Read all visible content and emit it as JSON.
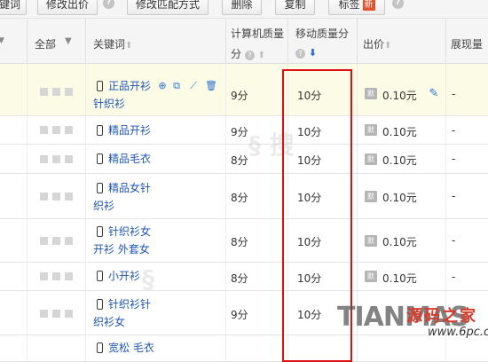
{
  "toolbar": {
    "btn_partial": "键词",
    "btn_modify_bid": "修改出价",
    "btn_modify_match": "修改匹配方式",
    "btn_delete": "删除",
    "btn_copy": "复制",
    "btn_tag": "标签",
    "badge_new": "新"
  },
  "header": {
    "col_all": "全部",
    "col_keyword": "关键词",
    "col_pc_quality_1": "计算机质量",
    "col_pc_quality_2": "分",
    "col_mobile_quality_1": "移动质量分",
    "col_bid": "出价",
    "col_impressions": "展现量",
    "sort_up": "⬆",
    "sort_down": "⬇",
    "help": "?"
  },
  "rows": [
    {
      "kw1": "正品开衫",
      "kw2": "针织衫",
      "pc": "9分",
      "mobile": "10分",
      "bid": "0.10元",
      "imp": "-"
    },
    {
      "kw1": "精品开衫",
      "kw2": "",
      "pc": "9分",
      "mobile": "10分",
      "bid": "0.10元",
      "imp": "-"
    },
    {
      "kw1": "精品毛衣",
      "kw2": "",
      "pc": "8分",
      "mobile": "10分",
      "bid": "0.10元",
      "imp": "-"
    },
    {
      "kw1": "精品女针",
      "kw2": "织衫",
      "pc": "8分",
      "mobile": "10分",
      "bid": "0.10元",
      "imp": "-"
    },
    {
      "kw1": "针织衫女",
      "kw2": "开衫 外套女",
      "pc": "8分",
      "mobile": "10分",
      "bid": "0.10元",
      "imp": "-"
    },
    {
      "kw1": "小开衫",
      "kw2": "",
      "pc": "8分",
      "mobile": "10分",
      "bid": "0.10元",
      "imp": "-"
    },
    {
      "kw1": "针织衫针",
      "kw2": "织衫女",
      "pc": "9分",
      "mobile": "10分",
      "bid": "0.10元",
      "imp": "-"
    },
    {
      "kw1": "宽松 毛衣",
      "kw2": "",
      "pc": "",
      "mobile": "",
      "bid": "",
      "imp": ""
    }
  ],
  "price_icon_label": "默",
  "watermark": {
    "brand_en": "TIANMAS",
    "brand_cn": "源码之家",
    "url": "www.6pc.cn"
  },
  "colors": {
    "link": "#1f56b8",
    "highlight_row": "#fcfce6",
    "red_frame": "#e01010",
    "accent_blue": "#2e6fd2"
  }
}
